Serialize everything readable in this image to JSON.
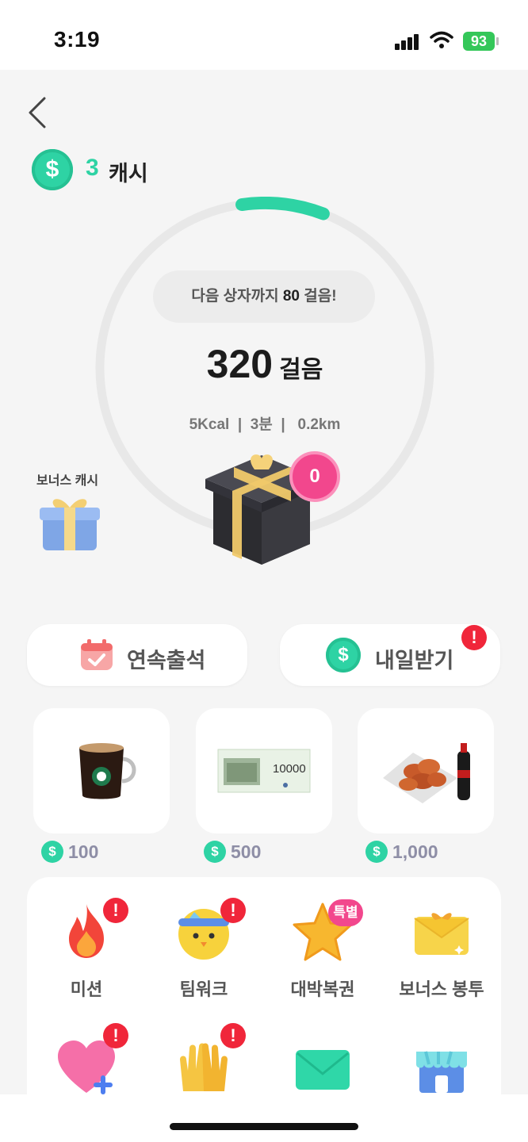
{
  "status_bar": {
    "time": "3:19",
    "battery": "93"
  },
  "header": {
    "coin_symbol": "$",
    "cash_amount": "3",
    "cash_unit": "캐시"
  },
  "progress": {
    "next_box_prefix": "다음 상자까지 ",
    "next_box_steps": "80",
    "next_box_suffix": " 걸음!",
    "steps": "320",
    "steps_unit": "걸음",
    "stats": "5Kcal  |  3분  |   0.2km",
    "ring_fraction": 0.08
  },
  "bonus": {
    "label": "보너스 캐시"
  },
  "box": {
    "count": "0"
  },
  "actions": [
    {
      "label": "연속출석",
      "icon": "calendar-check-icon"
    },
    {
      "label": "내일받기",
      "icon": "coin-icon",
      "alert": "!"
    }
  ],
  "rewards": [
    {
      "name": "coffee",
      "price": "100",
      "icon": "coffee-mug-icon"
    },
    {
      "name": "gift-voucher",
      "price": "500",
      "icon": "gift-certificate-icon",
      "voucher_value": "10000"
    },
    {
      "name": "chicken-set",
      "price": "1,000",
      "icon": "fried-chicken-icon"
    }
  ],
  "menu": [
    {
      "label": "미션",
      "icon": "fire-icon",
      "badge": "!"
    },
    {
      "label": "팀워크",
      "icon": "chick-headband-icon",
      "badge": "!"
    },
    {
      "label": "대박복권",
      "icon": "star-icon",
      "badge": "특별"
    },
    {
      "label": "보너스 봉투",
      "icon": "envelope-icon"
    },
    {
      "label": "",
      "icon": "heart-plus-icon",
      "badge": "!"
    },
    {
      "label": "",
      "icon": "high-five-icon",
      "badge": "!"
    },
    {
      "label": "",
      "icon": "mail-icon"
    },
    {
      "label": "",
      "icon": "store-icon"
    }
  ],
  "colors": {
    "accent": "#2ed3a4",
    "badge_pink": "#f2478d",
    "alert_red": "#f0263a",
    "muted_text": "#8e8ea6"
  }
}
